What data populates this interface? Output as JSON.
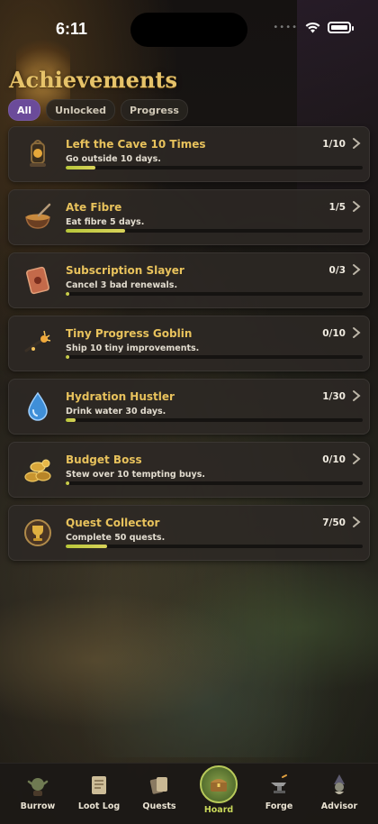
{
  "status_bar": {
    "time": "6:11"
  },
  "page": {
    "title": "Achievements"
  },
  "filters": [
    {
      "label": "All",
      "active": true
    },
    {
      "label": "Unlocked",
      "active": false
    },
    {
      "label": "Progress",
      "active": false
    }
  ],
  "achievements": [
    {
      "title": "Left the Cave 10 Times",
      "description": "Go outside 10 days.",
      "count": "1/10",
      "progress": 0.1,
      "icon": "lantern-icon"
    },
    {
      "title": "Ate Fibre",
      "description": "Eat fibre 5 days.",
      "count": "1/5",
      "progress": 0.2,
      "icon": "bowl-icon"
    },
    {
      "title": "Subscription Slayer",
      "description": "Cancel 3 bad renewals.",
      "count": "0/3",
      "progress": 0.0,
      "icon": "scroll-card-icon"
    },
    {
      "title": "Tiny Progress Goblin",
      "description": "Ship 10 tiny improvements.",
      "count": "0/10",
      "progress": 0.0,
      "icon": "spark-tool-icon"
    },
    {
      "title": "Hydration Hustler",
      "description": "Drink water 30 days.",
      "count": "1/30",
      "progress": 0.033,
      "icon": "water-drop-icon"
    },
    {
      "title": "Budget Boss",
      "description": "Stew over 10 tempting buys.",
      "count": "0/10",
      "progress": 0.0,
      "icon": "coin-pile-icon"
    },
    {
      "title": "Quest Collector",
      "description": "Complete 50 quests.",
      "count": "7/50",
      "progress": 0.14,
      "icon": "trophy-medallion-icon"
    }
  ],
  "tab_bar": [
    {
      "label": "Burrow",
      "icon": "goblin-icon",
      "selected": false
    },
    {
      "label": "Loot Log",
      "icon": "scroll-icon",
      "selected": false
    },
    {
      "label": "Quests",
      "icon": "cards-icon",
      "selected": false
    },
    {
      "label": "Hoard",
      "icon": "treasure-chest-icon",
      "selected": true
    },
    {
      "label": "Forge",
      "icon": "anvil-icon",
      "selected": false
    },
    {
      "label": "Advisor",
      "icon": "wizard-icon",
      "selected": false
    }
  ],
  "colors": {
    "accent_purple": "#6b4b9a",
    "gold_text": "#e8c25c",
    "progress": "#c6cf45",
    "hoard_green": "#8aa04a"
  }
}
